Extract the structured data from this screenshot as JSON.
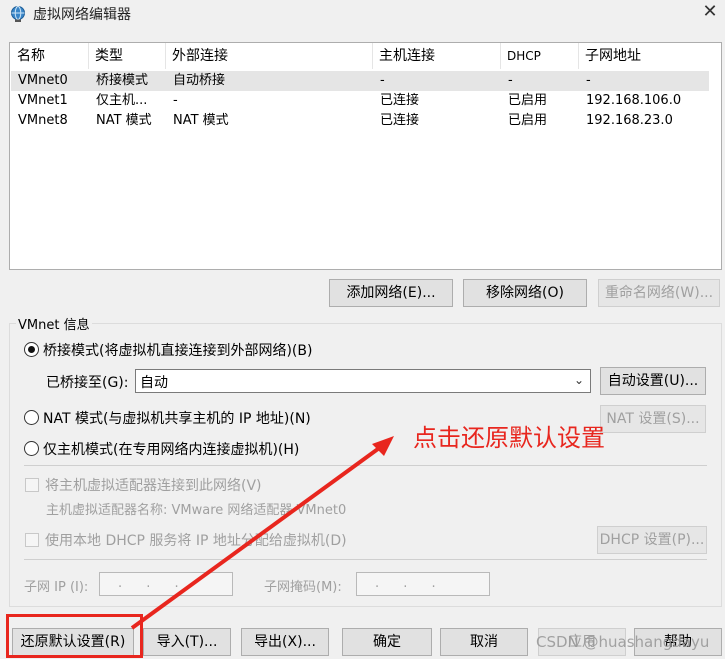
{
  "window": {
    "title": "虚拟网络编辑器",
    "icon": "network-globe-icon",
    "close_glyph": "✕"
  },
  "table": {
    "headers": [
      "名称",
      "类型",
      "外部连接",
      "主机连接",
      "DHCP",
      "子网地址"
    ],
    "rows": [
      {
        "name": "VMnet0",
        "type": "桥接模式",
        "external": "自动桥接",
        "host": "-",
        "dhcp": "-",
        "subnet": "-"
      },
      {
        "name": "VMnet1",
        "type": "仅主机...",
        "external": "-",
        "host": "已连接",
        "dhcp": "已启用",
        "subnet": "192.168.106.0"
      },
      {
        "name": "VMnet8",
        "type": "NAT 模式",
        "external": "NAT 模式",
        "host": "已连接",
        "dhcp": "已启用",
        "subnet": "192.168.23.0"
      }
    ]
  },
  "list_buttons": {
    "add": "添加网络(E)...",
    "remove": "移除网络(O)",
    "rename": "重命名网络(W)..."
  },
  "vmnet_info": {
    "group_title": "VMnet 信息",
    "bridge_radio": "桥接模式(将虚拟机直接连接到外部网络)(B)",
    "bridged_to_label": "已桥接至(G):",
    "bridged_to_value": "自动",
    "auto_settings_button": "自动设置(U)...",
    "nat_radio": "NAT 模式(与虚拟机共享主机的 IP 地址)(N)",
    "nat_settings_button": "NAT 设置(S)...",
    "hostonly_radio": "仅主机模式(在专用网络内连接虚拟机)(H)",
    "connect_adapter_check": "将主机虚拟适配器连接到此网络(V)",
    "adapter_name_label": "主机虚拟适配器名称: VMware 网络适配器 VMnet0",
    "dhcp_check": "使用本地 DHCP 服务将 IP 地址分配给虚拟机(D)",
    "dhcp_settings_button": "DHCP 设置(P)...",
    "subnet_ip_label": "子网 IP (I):",
    "subnet_ip_value": ". . .",
    "subnet_mask_label": "子网掩码(M):",
    "subnet_mask_value": ". . ."
  },
  "footer_buttons": {
    "restore": "还原默认设置(R)",
    "import": "导入(T)...",
    "export": "导出(X)...",
    "ok": "确定",
    "cancel": "取消",
    "apply": "应用",
    "help": "帮助"
  },
  "annotation": {
    "text": "点击还原默认设置",
    "color": "#e8261e"
  },
  "watermark": "CSDN @huashangdayu"
}
